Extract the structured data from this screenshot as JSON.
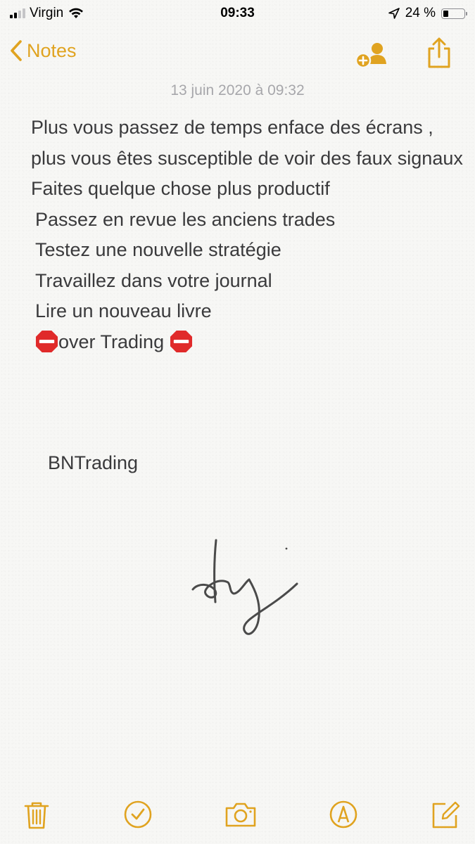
{
  "status_bar": {
    "carrier": "Virgin",
    "time": "09:33",
    "battery_percent": "24 %",
    "battery_level": 0.24,
    "signal_bars": 2
  },
  "nav": {
    "back_label": "Notes",
    "icons": [
      "add-people-icon",
      "share-icon"
    ]
  },
  "note": {
    "date": "13 juin 2020 à 09:32",
    "paragraph": "Plus vous passez de temps enface des écrans , plus vous êtes susceptible de voir des faux signaux Faites quelque chose plus productif",
    "list": [
      "Passez en revue les anciens trades",
      "Testez une nouvelle stratégie",
      "Travaillez dans votre journal",
      "Lire un nouveau livre"
    ],
    "stop_line": "over Trading",
    "signature": "BNTrading"
  },
  "toolbar": {
    "icons": [
      "trash-icon",
      "checklist-icon",
      "camera-icon",
      "markup-icon",
      "compose-icon"
    ]
  },
  "colors": {
    "accent": "#e0a320",
    "text": "#3a3a3c",
    "date": "#a7a7ab",
    "stop_sign": "#e02a2a"
  }
}
